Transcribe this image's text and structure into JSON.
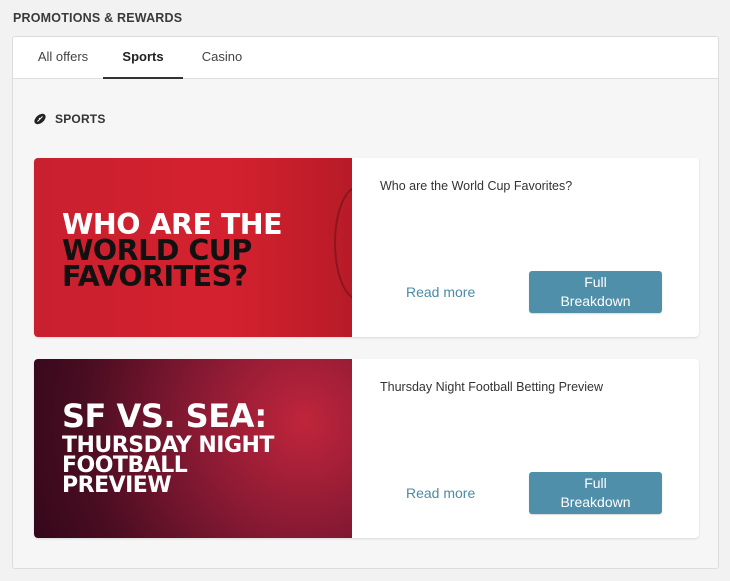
{
  "section_title": "PROMOTIONS & REWARDS",
  "tabs": [
    {
      "label": "All offers"
    },
    {
      "label": "Sports"
    },
    {
      "label": "Casino"
    }
  ],
  "sub_heading": {
    "label": "SPORTS",
    "icon": "football-icon"
  },
  "cards": [
    {
      "image_line_a": "WHO ARE THE",
      "image_line_b": "WORLD CUP\nFAVORITES?",
      "title": "Who are the World Cup Favorites?",
      "read_more": "Read more",
      "button": "Full Breakdown"
    },
    {
      "image_line_a": "SF VS. SEA:",
      "image_line_b": "THURSDAY NIGHT\nFOOTBALL\nPREVIEW",
      "title": "Thursday Night Football Betting Preview",
      "read_more": "Read more",
      "button": "Full Breakdown"
    }
  ],
  "colors": {
    "accent": "#4f8fa9",
    "link": "#4a8ba6",
    "card1_bg": "#d5212f",
    "card2_bg": "#4a0d22"
  }
}
